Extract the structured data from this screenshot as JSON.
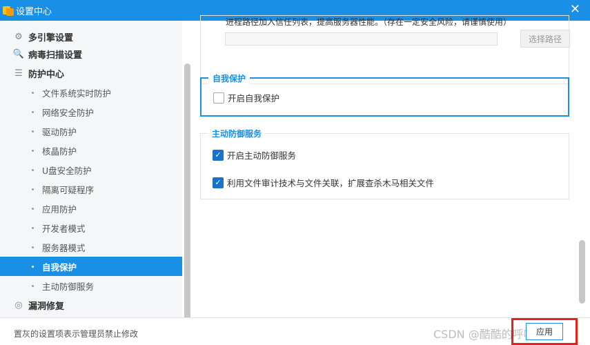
{
  "window": {
    "title": "设置中心",
    "close_glyph": "✕"
  },
  "sidebar": {
    "groups": [
      {
        "label": "多引擎设置",
        "icon": "gear-icon",
        "glyph": "⚙"
      },
      {
        "label": "病毒扫描设置",
        "icon": "search-icon",
        "glyph": "🔍"
      },
      {
        "label": "防护中心",
        "icon": "list-icon",
        "glyph": "☰"
      }
    ],
    "items": [
      "文件系统实时防护",
      "网络安全防护",
      "驱动防护",
      "核晶防护",
      "U盘安全防护",
      "隔离可疑程序",
      "应用防护",
      "开发者模式",
      "服务器模式",
      "自我保护",
      "主动防御服务"
    ],
    "active_item": "自我保护",
    "bottom_group": {
      "label": "漏洞修复",
      "icon": "shield-icon",
      "glyph": "◎"
    }
  },
  "main": {
    "top_description": "进程路径加入信任列表，提高服务器性能。（存在一定安全风险，请谨慎使用）",
    "path_value": "",
    "choose_path_label": "选择路径",
    "self_protect": {
      "title": "自我保护",
      "option": {
        "label": "开启自我保护",
        "checked": false
      }
    },
    "active_defense": {
      "title": "主动防御服务",
      "options": [
        {
          "label": "开启主动防御服务",
          "checked": true
        },
        {
          "label": "利用文件审计技术与文件关联，扩展查杀木马相关文件",
          "checked": true
        }
      ]
    }
  },
  "footer": {
    "note": "置灰的设置项表示管理员禁止修改",
    "watermark": "CSDN @酷酷的呼呼呼啦",
    "apply_label": "应用"
  },
  "colors": {
    "accent": "#1a8fe6",
    "highlight_box": "#e2231a"
  }
}
